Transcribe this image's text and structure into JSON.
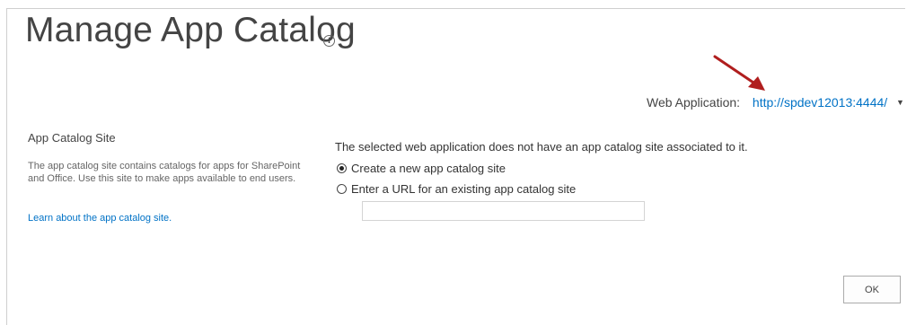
{
  "page": {
    "title": "Manage App Catalog",
    "info_icon": "info-icon"
  },
  "web_application": {
    "label": "Web Application:",
    "value": "http://spdev12013:4444/",
    "dropdown_icon": "caret-down-icon"
  },
  "section": {
    "heading": "App Catalog Site",
    "description": "The app catalog site contains catalogs for apps for SharePoint and Office. Use this site to make apps available to end users.",
    "learn_link": "Learn about the app catalog site."
  },
  "main": {
    "status_message": "The selected web application does not have an app catalog site associated to it.",
    "options": [
      {
        "label": "Create a new app catalog site",
        "checked": true
      },
      {
        "label": "Enter a URL for an existing app catalog site",
        "checked": false
      }
    ],
    "url_input_value": ""
  },
  "buttons": {
    "ok_label": "OK"
  },
  "colors": {
    "link": "#0072c6",
    "annotation_arrow": "#b01e1e",
    "text": "#444444"
  }
}
